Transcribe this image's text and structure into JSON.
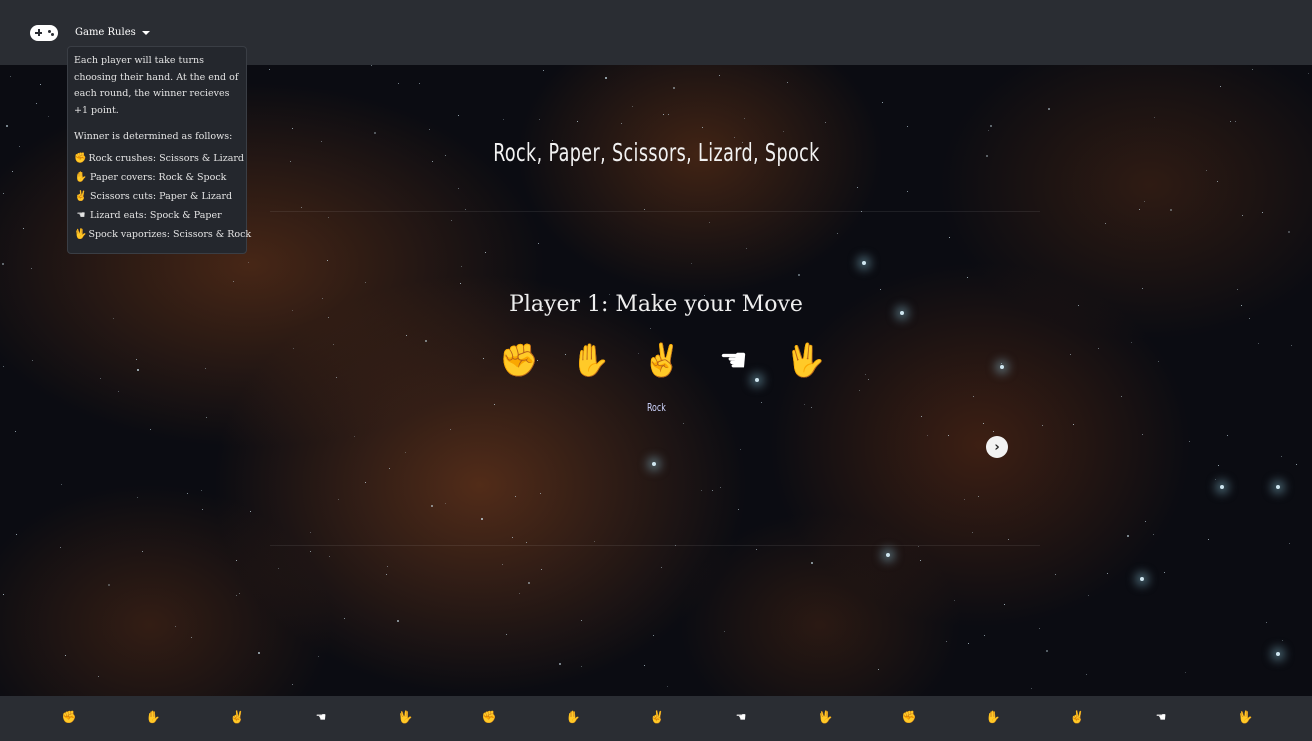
{
  "navbar": {
    "logo_icon": "gamepad-icon",
    "rules_label": "Game Rules"
  },
  "rules": {
    "intro": "Each player will take turns choosing their hand. At the end of each round, the winner recieves +1 point.",
    "winner_heading": "Winner is determined as follows:",
    "items": [
      {
        "icon": "rock-hand-icon",
        "glyph": "✊",
        "text": "Rock crushes: Scissors & Lizard"
      },
      {
        "icon": "paper-hand-icon",
        "glyph": "✋",
        "text": "Paper covers: Rock & Spock"
      },
      {
        "icon": "scissors-hand-icon",
        "glyph": "✌",
        "text": "Scissors cuts: Paper & Lizard"
      },
      {
        "icon": "lizard-hand-icon",
        "glyph": "☚",
        "text": "Lizard eats: Spock & Paper"
      },
      {
        "icon": "spock-hand-icon",
        "glyph": "🖖",
        "text": "Spock vaporizes: Scissors & Rock"
      }
    ]
  },
  "main": {
    "title": "Rock, Paper, Scissors, Lizard, Spock",
    "prompt": "Player 1: Make your Move",
    "selected_choice": "Rock",
    "hands": [
      {
        "icon": "rock-hand-icon",
        "glyph": "✊"
      },
      {
        "icon": "paper-hand-icon",
        "glyph": "✋"
      },
      {
        "icon": "scissors-hand-icon",
        "glyph": "✌"
      },
      {
        "icon": "lizard-hand-icon",
        "glyph": "☚"
      },
      {
        "icon": "spock-hand-icon",
        "glyph": "🖖"
      }
    ],
    "next_icon": "chevron-right-icon",
    "next_glyph": "›"
  },
  "footer": {
    "icons": [
      {
        "icon": "rock-hand-icon",
        "glyph": "✊"
      },
      {
        "icon": "paper-hand-icon",
        "glyph": "✋"
      },
      {
        "icon": "scissors-hand-icon",
        "glyph": "✌"
      },
      {
        "icon": "lizard-hand-icon",
        "glyph": "☚"
      },
      {
        "icon": "spock-hand-icon",
        "glyph": "🖖"
      },
      {
        "icon": "rock-hand-icon",
        "glyph": "✊"
      },
      {
        "icon": "paper-hand-icon",
        "glyph": "✋"
      },
      {
        "icon": "scissors-hand-icon",
        "glyph": "✌"
      },
      {
        "icon": "lizard-hand-icon",
        "glyph": "☚"
      },
      {
        "icon": "spock-hand-icon",
        "glyph": "🖖"
      },
      {
        "icon": "rock-hand-icon",
        "glyph": "✊"
      },
      {
        "icon": "paper-hand-icon",
        "glyph": "✋"
      },
      {
        "icon": "scissors-hand-icon",
        "glyph": "✌"
      },
      {
        "icon": "lizard-hand-icon",
        "glyph": "☚"
      },
      {
        "icon": "spock-hand-icon",
        "glyph": "🖖"
      }
    ]
  },
  "colors": {
    "navbar": "#2a2d33",
    "background": "#0b0c12",
    "nebula": "#8c461e",
    "choice_label": "#cfd6ff"
  }
}
